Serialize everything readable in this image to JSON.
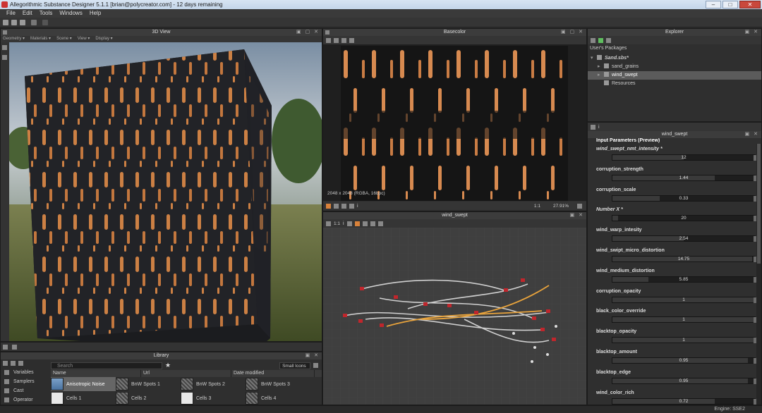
{
  "titlebar": {
    "title": "Allegorithmic Substance Designer 5.1.1 [brian@polycreator.com] - 12 days remaining",
    "min": "–",
    "max": "□",
    "close": "✕"
  },
  "menu": [
    "File",
    "Edit",
    "Tools",
    "Windows",
    "Help"
  ],
  "view3d": {
    "title": "3D View",
    "submenu": [
      "Geometry ▾",
      "Materials ▾",
      "Scene ▾",
      "View ▾",
      "Display ▾"
    ]
  },
  "basecolor": {
    "title": "Basecolor",
    "overlay": "2048 x 2048 (RGBA, 16bpc)",
    "ratio": "1:1",
    "zoom": "27.91%"
  },
  "graph": {
    "title": "wind_swept",
    "ratio": "1:1"
  },
  "explorer": {
    "title": "Explorer",
    "section": "User's Packages",
    "items": [
      {
        "label": "Sand.sbs*",
        "level": 1,
        "selected": false,
        "italic": true
      },
      {
        "label": "sand_grains",
        "level": 2,
        "selected": false
      },
      {
        "label": "wind_swept",
        "level": 2,
        "selected": true
      },
      {
        "label": "Resources",
        "level": 2,
        "selected": false
      }
    ]
  },
  "params": {
    "title": "wind_swept",
    "section": "Input Parameters (Preview)",
    "items": [
      {
        "label": "wind_swept_nmt_intensity *",
        "value": "12",
        "fill": 0.5,
        "italic": true
      },
      {
        "label": "corruption_strength",
        "value": "1.44",
        "fill": 0.72
      },
      {
        "label": "corruption_scale",
        "value": "0.33",
        "fill": 0.33
      },
      {
        "label": "Number X *",
        "value": "20",
        "fill": 0.04,
        "italic": true
      },
      {
        "label": "wind_warp_intesity",
        "value": "2.54",
        "fill": 0.5
      },
      {
        "label": "wind_swipt_micro_distortion",
        "value": "14.75",
        "fill": 0.98
      },
      {
        "label": "wind_medium_distortion",
        "value": "5.85",
        "fill": 0.25
      },
      {
        "label": "corruption_opacity",
        "value": "1",
        "fill": 1.0
      },
      {
        "label": "black_color_override",
        "value": "1",
        "fill": 1.0
      },
      {
        "label": "blacktop_opacity",
        "value": "1",
        "fill": 1.0
      },
      {
        "label": "blacktop_amount",
        "value": "0.95",
        "fill": 0.95
      },
      {
        "label": "blacktop_edge",
        "value": "0.95",
        "fill": 0.95
      },
      {
        "label": "wind_color_rich",
        "value": "0.72",
        "fill": 0.72
      }
    ]
  },
  "library": {
    "title": "Library",
    "search_placeholder": "Search",
    "view_mode": "Small Icons",
    "columns": [
      "Name",
      "Url",
      "Date modified"
    ],
    "categories": [
      "Variables",
      "Samplers",
      "Cast",
      "Operator"
    ],
    "items": [
      {
        "label": "Anisotropic Noise",
        "thumb": "blue",
        "selected": true
      },
      {
        "label": "BnW Spots 1",
        "thumb": "noise",
        "selected": false
      },
      {
        "label": "BnW Spots 2",
        "thumb": "noise",
        "selected": false
      },
      {
        "label": "BnW Spots 3",
        "thumb": "noise",
        "selected": false
      },
      {
        "label": "Cells 1",
        "thumb": "white",
        "selected": false
      },
      {
        "label": "Cells 2",
        "thumb": "noise",
        "selected": false
      },
      {
        "label": "Cells 3",
        "thumb": "white",
        "selected": false
      },
      {
        "label": "Cells 4",
        "thumb": "noise",
        "selected": false
      }
    ]
  },
  "status": {
    "engine": "Engine: SSE2"
  },
  "colors": {
    "accent_orange": "#d9823a",
    "panel": "#2f2f2f",
    "selection": "#5b5b5b"
  }
}
